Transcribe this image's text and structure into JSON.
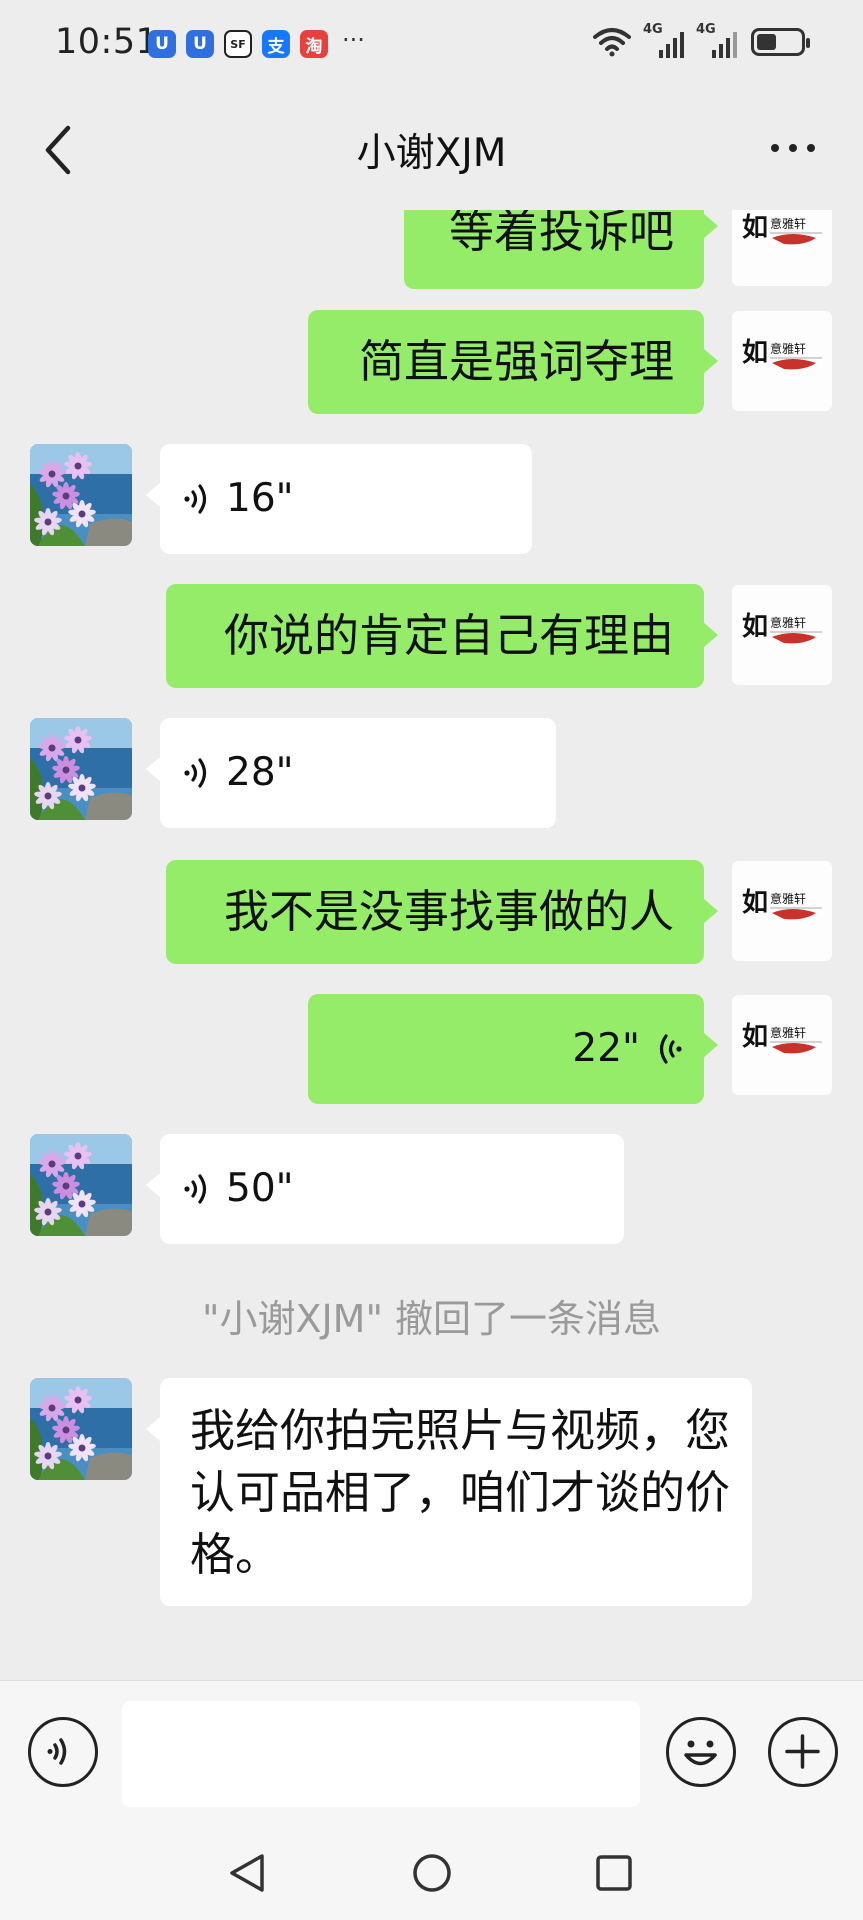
{
  "status_bar": {
    "time": "10:51",
    "app_icons": [
      {
        "name": "app-shield-icon",
        "glyph": "U",
        "color": "#2f6fdf"
      },
      {
        "name": "app-shield-icon-2",
        "glyph": "U",
        "color": "#2f6fdf"
      },
      {
        "name": "sf-express-icon",
        "glyph": "SF",
        "color": "#222222"
      },
      {
        "name": "alipay-icon",
        "glyph": "支",
        "color": "#1677ff"
      },
      {
        "name": "taobao-icon",
        "glyph": "淘",
        "color": "#e8403c"
      }
    ],
    "more_dots": "···",
    "network_1": "4G",
    "network_2": "4G",
    "battery_level": 0.45
  },
  "header": {
    "title": "小谢XJM",
    "back_icon": "chevron-left-icon",
    "more_icon": "more-dots-icon"
  },
  "messages": [
    {
      "side": "right",
      "type": "text",
      "text": "等着投诉吧"
    },
    {
      "side": "right",
      "type": "text",
      "text": "简直是强词夺理"
    },
    {
      "side": "left",
      "type": "voice",
      "duration": "16\""
    },
    {
      "side": "right",
      "type": "text",
      "text": "你说的肯定自己有理由"
    },
    {
      "side": "left",
      "type": "voice",
      "duration": "28\""
    },
    {
      "side": "right",
      "type": "text",
      "text": "我不是没事找事做的人"
    },
    {
      "side": "right",
      "type": "voice",
      "duration": "22\""
    },
    {
      "side": "left",
      "type": "voice",
      "duration": "50\""
    },
    {
      "type": "system",
      "text": "\"小谢XJM\" 撤回了一条消息"
    },
    {
      "side": "left",
      "type": "text",
      "text": "我给你拍完照片与视频，您认可品相了，咱们才谈的价格。"
    }
  ],
  "my_avatar_text": "如意雅轩",
  "input_bar": {
    "voice_icon": "voice-mode-icon",
    "emoji_icon": "emoji-icon",
    "plus_icon": "plus-icon"
  },
  "system_nav": {
    "back_icon": "triangle-back-icon",
    "home_icon": "circle-home-icon",
    "recents_icon": "square-recents-icon"
  },
  "colors": {
    "background": "#ededed",
    "bubble_mine": "#95ec69",
    "bubble_theirs": "#ffffff",
    "recall_text": "#9a9a9a"
  }
}
